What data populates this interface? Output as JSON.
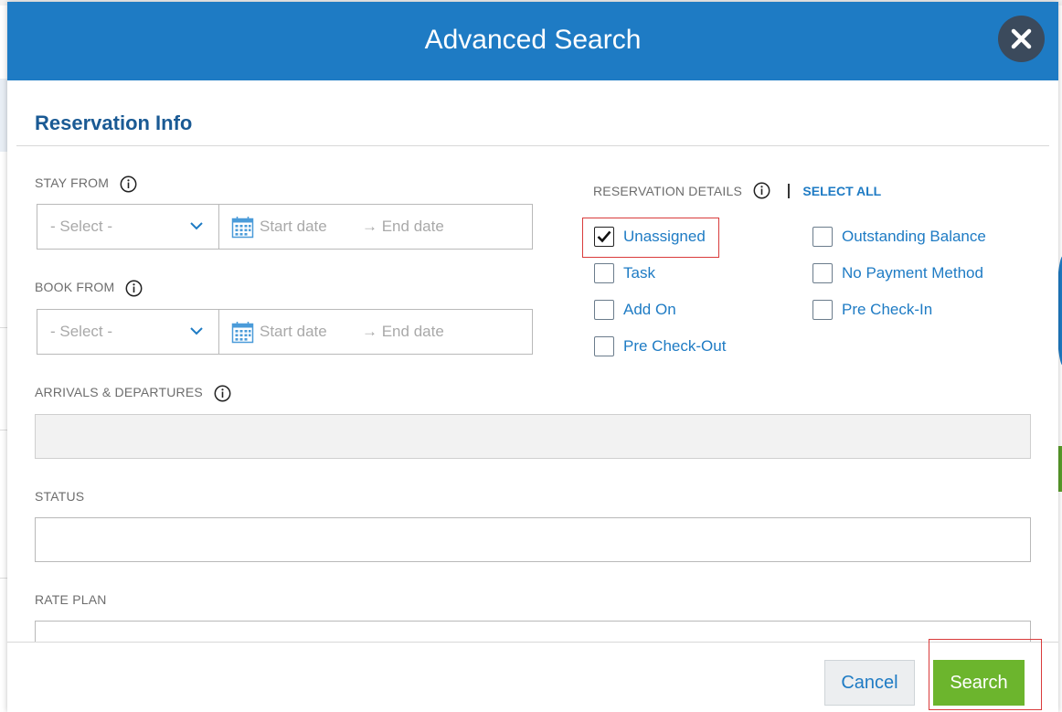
{
  "modal": {
    "title": "Advanced Search"
  },
  "section": {
    "title": "Reservation Info"
  },
  "stay_from": {
    "label": "STAY FROM",
    "select_placeholder": "- Select -",
    "start_placeholder": "Start date",
    "end_placeholder": "→ End date"
  },
  "book_from": {
    "label": "BOOK FROM",
    "select_placeholder": "- Select -",
    "start_placeholder": "Start date",
    "end_placeholder": "→ End date"
  },
  "arrivals": {
    "label": "ARRIVALS & DEPARTURES",
    "value": ""
  },
  "status": {
    "label": "STATUS",
    "value": ""
  },
  "rate_plan": {
    "label": "RATE PLAN",
    "value": ""
  },
  "reservation_details": {
    "label": "RESERVATION DETAILS",
    "select_all": "SELECT ALL",
    "options": [
      {
        "label": "Unassigned",
        "checked": true
      },
      {
        "label": "Outstanding Balance",
        "checked": false
      },
      {
        "label": "Task",
        "checked": false
      },
      {
        "label": "No Payment Method",
        "checked": false
      },
      {
        "label": "Add On",
        "checked": false
      },
      {
        "label": "Pre Check-In",
        "checked": false
      },
      {
        "label": "Pre Check-Out",
        "checked": false
      }
    ]
  },
  "footer": {
    "cancel_label": "Cancel",
    "search_label": "Search"
  },
  "colors": {
    "header": "#1e7bc4",
    "link": "#1e7bc4",
    "search_button": "#6cb52d",
    "highlight": "#d93b3b"
  }
}
